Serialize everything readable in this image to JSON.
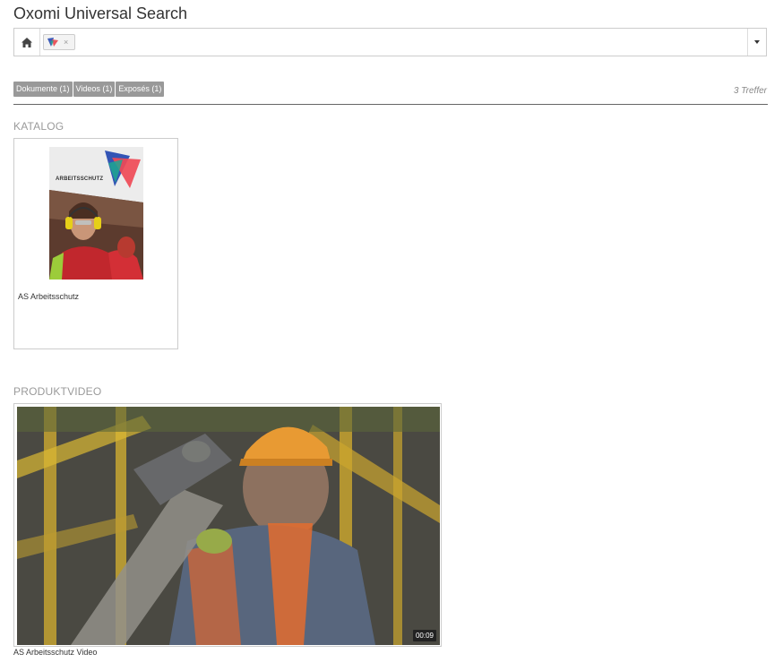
{
  "app": {
    "title": "Oxomi Universal Search"
  },
  "search": {
    "home_icon": "home-icon",
    "tag_remove": "×",
    "dropdown_icon": "caret-down-icon"
  },
  "filters": {
    "buttons": [
      {
        "label": "Dokumente (1)"
      },
      {
        "label": "Videos (1)"
      },
      {
        "label": "Exposés (1)"
      }
    ],
    "hits": "3 Treffer"
  },
  "sections": {
    "katalog": {
      "title": "KATALOG",
      "item": {
        "cover_text": "ARBEITSSCHUTZ",
        "caption": "AS Arbeitsschutz"
      }
    },
    "produktvideo": {
      "title": "PRODUKTVIDEO",
      "item": {
        "duration": "00:09",
        "caption": "AS Arbeitsschutz Video"
      }
    }
  },
  "colors": {
    "filter_button": "#999999",
    "divider": "#666666",
    "section_title": "#9a9a9a"
  }
}
